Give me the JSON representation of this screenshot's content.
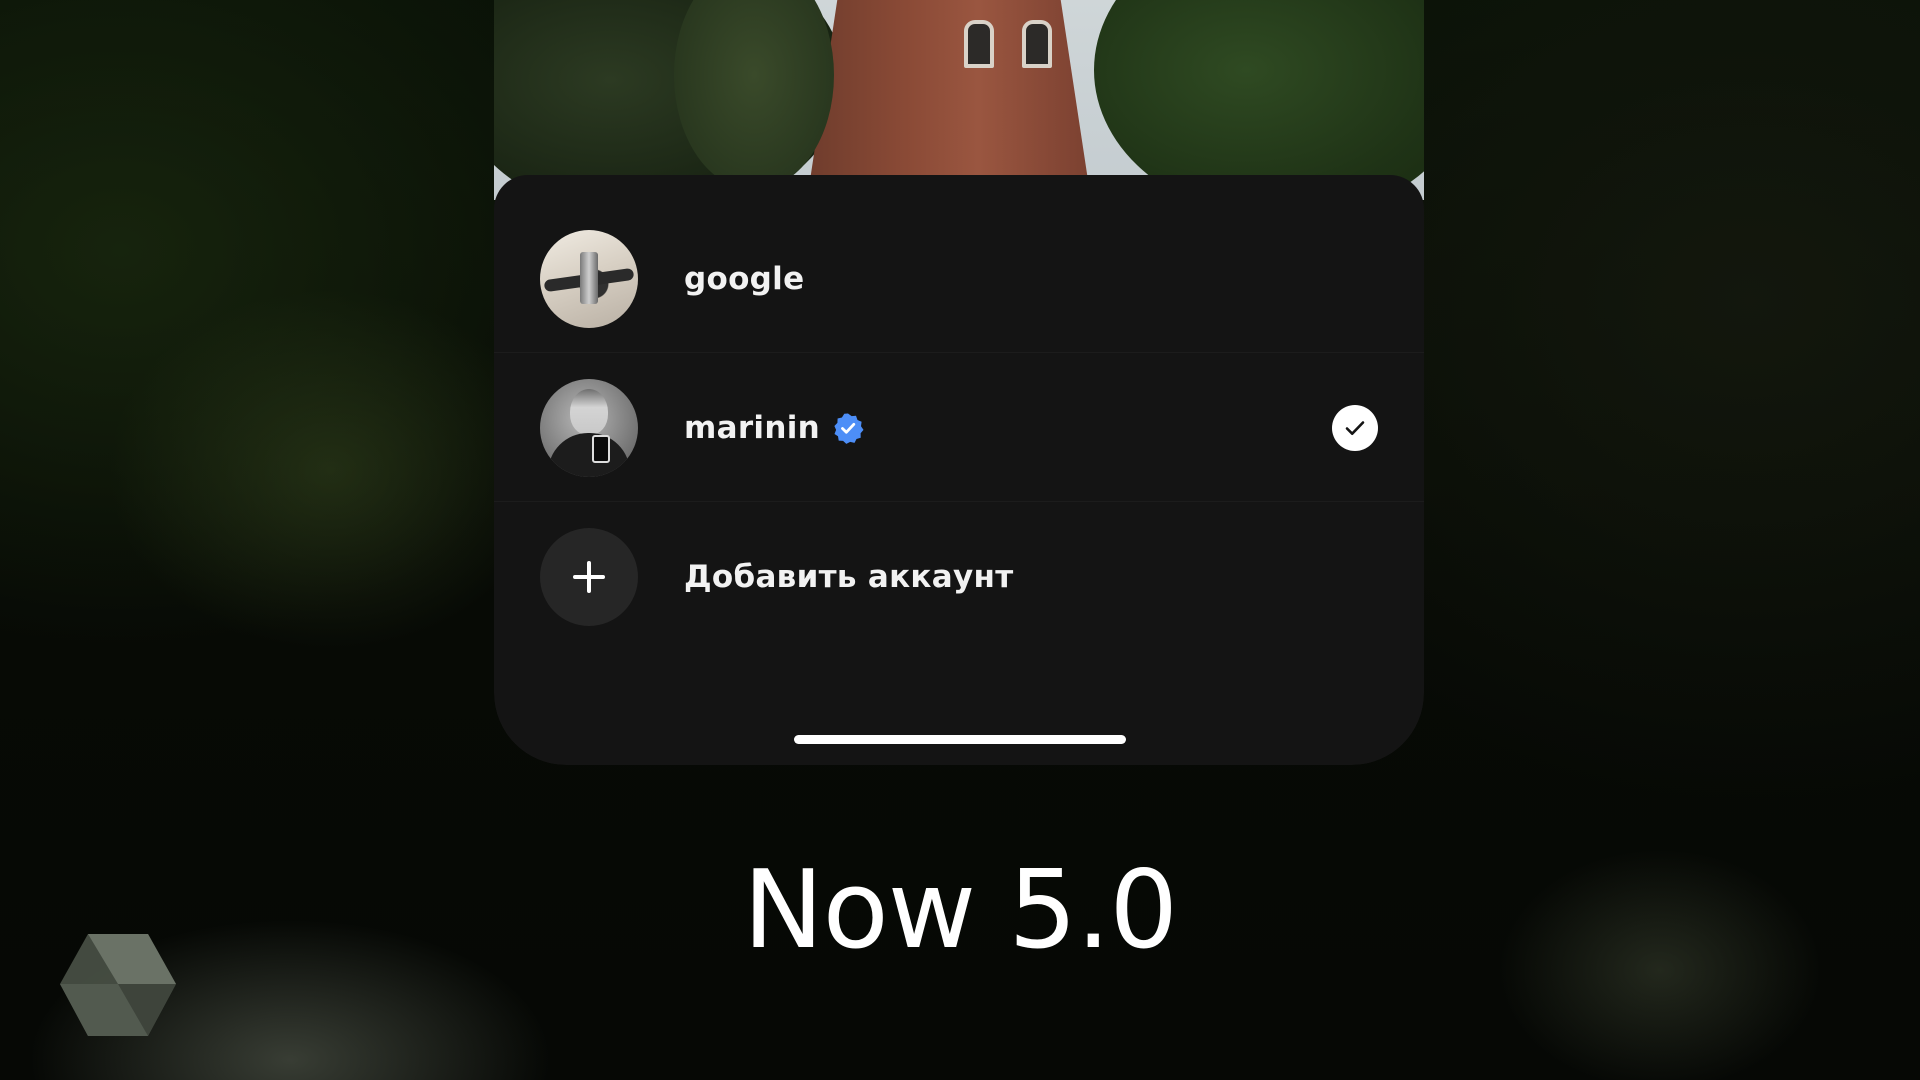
{
  "accounts": [
    {
      "name": "google",
      "verified": false,
      "selected": false,
      "avatar_icon": "avatar-google"
    },
    {
      "name": "marinin",
      "verified": true,
      "selected": true,
      "avatar_icon": "avatar-marinin"
    }
  ],
  "add_account": {
    "label": "Добавить аккаунт",
    "icon": "plus-icon"
  },
  "caption": "Now 5.0",
  "colors": {
    "sheet_background": "#141414",
    "verified_badge": "#4d8ef7",
    "text": "#f2f2f2",
    "check_badge": "#ffffff"
  },
  "icons": {
    "verified": "verified-badge-icon",
    "selected": "checkmark-icon",
    "brand": "cube-logo-icon"
  }
}
